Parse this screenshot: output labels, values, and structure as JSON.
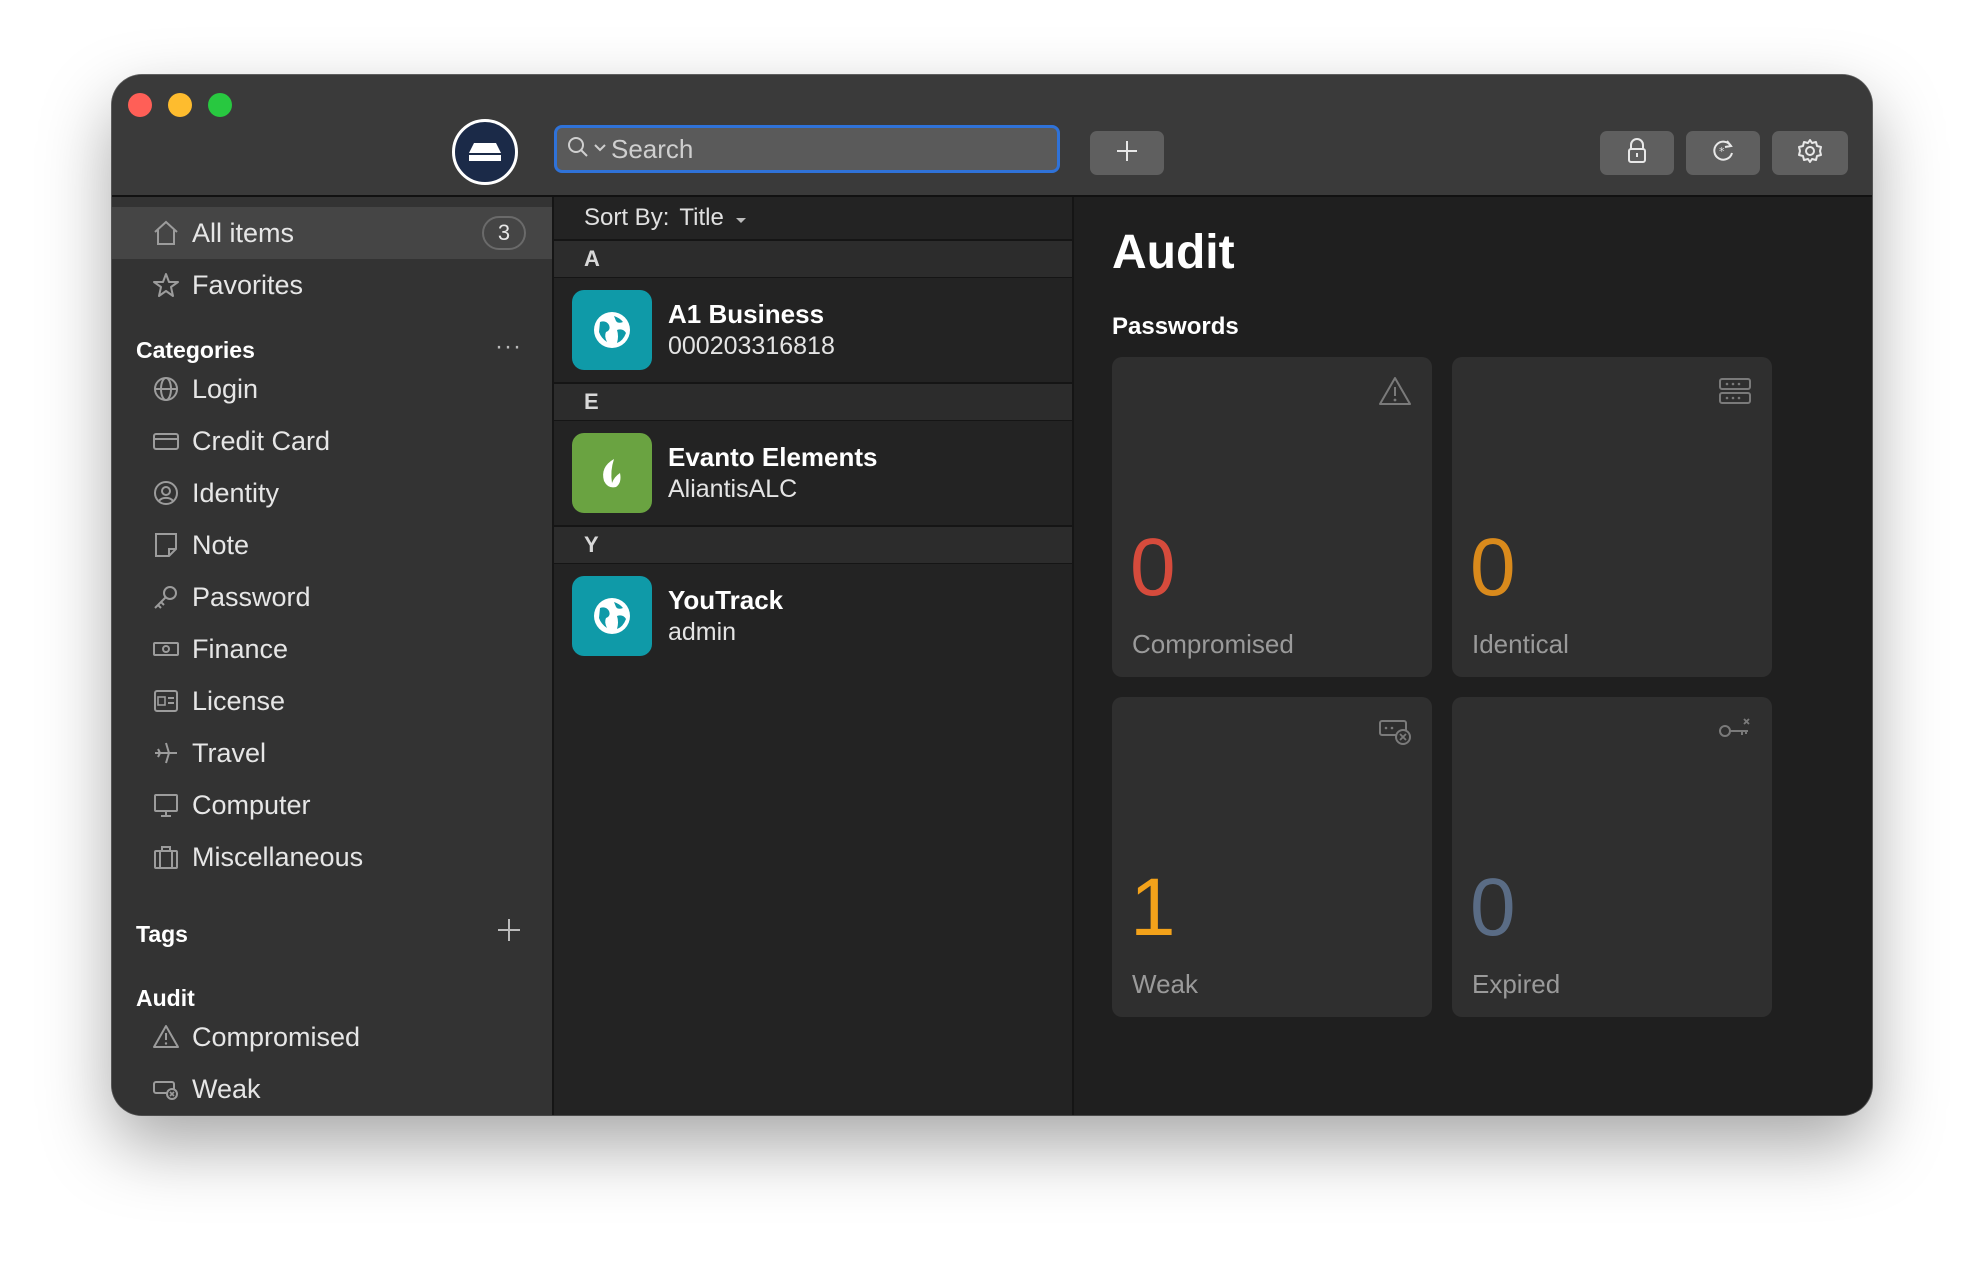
{
  "search": {
    "placeholder": "Search"
  },
  "sidebar": {
    "all_items": {
      "label": "All items",
      "count": "3"
    },
    "favorites": {
      "label": "Favorites"
    },
    "categories_heading": "Categories",
    "categories_action": "···",
    "categories": [
      {
        "label": "Login",
        "icon": "globe-icon"
      },
      {
        "label": "Credit Card",
        "icon": "credit-card-icon"
      },
      {
        "label": "Identity",
        "icon": "identity-icon"
      },
      {
        "label": "Note",
        "icon": "note-icon"
      },
      {
        "label": "Password",
        "icon": "key-icon"
      },
      {
        "label": "Finance",
        "icon": "finance-icon"
      },
      {
        "label": "License",
        "icon": "license-icon"
      },
      {
        "label": "Travel",
        "icon": "airplane-icon"
      },
      {
        "label": "Computer",
        "icon": "monitor-icon"
      },
      {
        "label": "Miscellaneous",
        "icon": "briefcase-icon"
      }
    ],
    "tags_heading": "Tags",
    "audit_heading": "Audit",
    "audit_items": [
      {
        "label": "Compromised",
        "icon": "warning-icon"
      },
      {
        "label": "Weak",
        "icon": "weak-password-icon"
      }
    ]
  },
  "list": {
    "sort_label": "Sort By:",
    "sort_value": "Title",
    "groups": [
      {
        "letter": "A",
        "items": [
          {
            "title": "A1 Business",
            "subtitle": "000203316818",
            "icon_color": "#0f9aa8"
          }
        ]
      },
      {
        "letter": "E",
        "items": [
          {
            "title": "Evanto Elements",
            "subtitle": "AliantisALC",
            "icon_color": "#6aa341"
          }
        ]
      },
      {
        "letter": "Y",
        "items": [
          {
            "title": "YouTrack",
            "subtitle": "admin",
            "icon_color": "#0f9aa8"
          }
        ]
      }
    ]
  },
  "detail": {
    "title": "Audit",
    "subtitle": "Passwords",
    "cards": [
      {
        "value": "0",
        "label": "Compromised",
        "color": "#d64b3c"
      },
      {
        "value": "0",
        "label": "Identical",
        "color": "#d98a1c"
      },
      {
        "value": "1",
        "label": "Weak",
        "color": "#f3a21a"
      },
      {
        "value": "0",
        "label": "Expired",
        "color": "#5a6c85"
      }
    ]
  },
  "colors": {
    "accent": "#2f72d8",
    "titlebar": "#3a3a3a",
    "sidebar": "#333333",
    "content": "#1f1f1f"
  }
}
